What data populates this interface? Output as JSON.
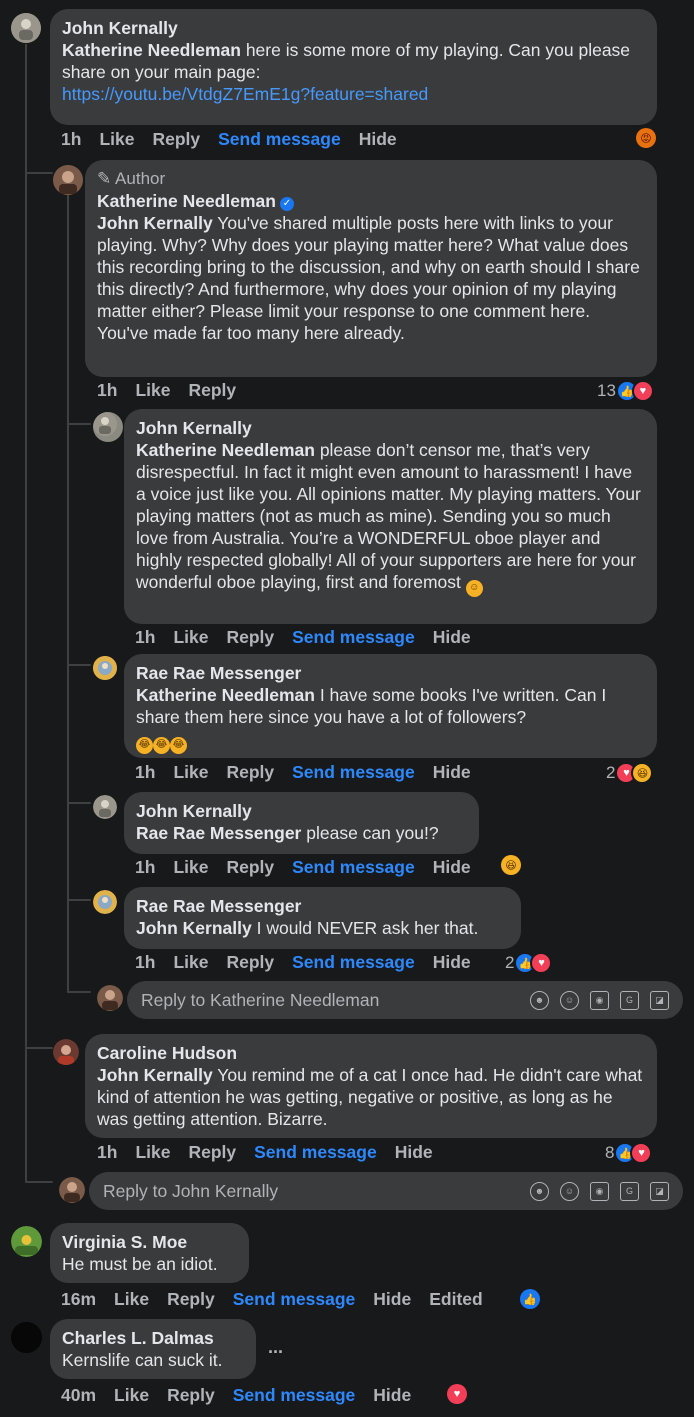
{
  "comments": {
    "c1": {
      "name": "John Kernally",
      "mention": "Katherine Needleman",
      "text": " here is some more of my playing. Can you please share on your main page:",
      "link": "https://youtu.be/VtdgZ7EmE1g?feature=shared",
      "time": "1h",
      "like": "Like",
      "reply": "Reply",
      "send": "Send message",
      "hide": "Hide"
    },
    "c2": {
      "author_tag": "Author",
      "name": "Katherine Needleman",
      "mention": "John Kernally",
      "text": " You've shared multiple posts here with links to your playing. Why? Why does your playing matter here? What value does this recording bring to the discussion, and why on earth should I share this directly? And furthermore, why does your opinion of my playing matter either? Please limit your response to one comment here. You've made far too many here already.",
      "time": "1h",
      "like": "Like",
      "reply": "Reply",
      "reactions": "13"
    },
    "c3": {
      "name": "John Kernally",
      "mention": "Katherine Needleman",
      "text": " please don’t censor me, that’s very disrespectful. In fact it might even amount to harassment! I have a voice just like you. All opinions matter. My playing matters. Your playing matters (not as much as mine). Sending you so much love from Australia. You’re a WONDERFUL oboe player and highly respected globally! All of your supporters are here for your wonderful oboe playing, first and foremost",
      "time": "1h",
      "like": "Like",
      "reply": "Reply",
      "send": "Send message",
      "hide": "Hide"
    },
    "c4": {
      "name": "Rae Rae Messenger",
      "mention": "Katherine Needleman",
      "text": " I have some books I've written. Can I share them here since you have a lot of followers?",
      "time": "1h",
      "like": "Like",
      "reply": "Reply",
      "send": "Send message",
      "hide": "Hide",
      "reactions": "2"
    },
    "c5": {
      "name": "John Kernally",
      "mention": "Rae Rae Messenger",
      "text": " please can you!?",
      "time": "1h",
      "like": "Like",
      "reply": "Reply",
      "send": "Send message",
      "hide": "Hide"
    },
    "c6": {
      "name": "Rae Rae Messenger",
      "mention": "John Kernally",
      "text": " I would NEVER ask her that.",
      "time": "1h",
      "like": "Like",
      "reply": "Reply",
      "send": "Send message",
      "hide": "Hide",
      "reactions": "2"
    },
    "c7": {
      "name": "Caroline Hudson",
      "mention": "John Kernally",
      "text": " You remind me of a cat I once had. He didn't care what kind of attention he was getting, negative or positive, as long as he was getting attention. Bizarre.",
      "time": "1h",
      "like": "Like",
      "reply": "Reply",
      "send": "Send message",
      "hide": "Hide",
      "reactions": "8"
    },
    "c8": {
      "name": "Virginia S. Moe",
      "text": "He must be an idiot.",
      "time": "16m",
      "like": "Like",
      "reply": "Reply",
      "send": "Send message",
      "hide": "Hide",
      "edited": "Edited"
    },
    "c9": {
      "name": "Charles L. Dalmas",
      "text": "Kernslife can suck it.",
      "more": "...",
      "time": "40m",
      "like": "Like",
      "reply": "Reply",
      "send": "Send message",
      "hide": "Hide"
    }
  },
  "reply_boxes": {
    "katherine": "Reply to Katherine Needleman",
    "john": "Reply to John Kernally"
  },
  "icons": [
    "angry-reaction",
    "like-reaction",
    "love-reaction",
    "haha-reaction",
    "verified-badge",
    "pencil-icon",
    "avatar-icon",
    "emoji-icon",
    "camera-icon",
    "gif-icon",
    "sticker-icon"
  ],
  "colors": {
    "background": "#18191a",
    "bubble": "#3a3b3c",
    "text": "#e4e6eb",
    "muted": "#b0b3b8",
    "link": "#4599ff",
    "send_message": "#2d88ff"
  }
}
